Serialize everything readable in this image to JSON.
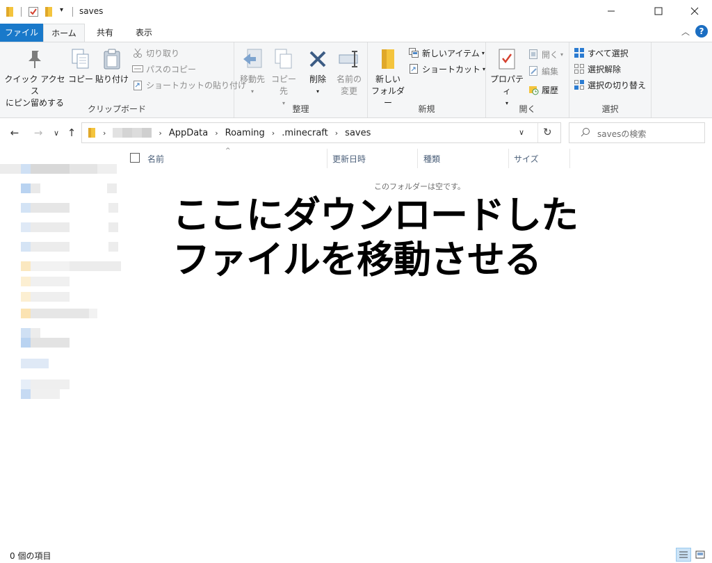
{
  "window": {
    "title": "saves",
    "minimize_glyph": "—",
    "maximize_glyph": "☐",
    "close_glyph": "✕",
    "qa_dropdown_glyph": "▾"
  },
  "tabs": [
    "ファイル",
    "ホーム",
    "共有",
    "表示"
  ],
  "help": {
    "collapse_glyph": "︿",
    "help_glyph": "?"
  },
  "ribbon": {
    "clipboard": {
      "label": "クリップボード",
      "pin_line1": "クイック アクセス",
      "pin_line2": "にピン留めする",
      "copy": "コピー",
      "paste": "貼り付け",
      "cut": "切り取り",
      "copy_path": "パスのコピー",
      "paste_shortcut": "ショートカットの貼り付け"
    },
    "organize": {
      "label": "整理",
      "move_to": "移動先",
      "copy_to": "コピー先",
      "delete": "削除",
      "rename_line1": "名前の",
      "rename_line2": "変更"
    },
    "new": {
      "label": "新規",
      "new_folder_line1": "新しい",
      "new_folder_line2": "フォルダー",
      "new_item": "新しいアイテム",
      "easy_access": "ショートカット"
    },
    "open": {
      "label": "開く",
      "properties": "プロパティ",
      "open": "開く",
      "edit": "編集",
      "history": "履歴"
    },
    "select": {
      "label": "選択",
      "select_all": "すべて選択",
      "select_none": "選択解除",
      "invert": "選択の切り替え"
    }
  },
  "nav": {
    "back": "←",
    "forward": "→",
    "recent": "∨",
    "up": "↑",
    "dropdown": "∨",
    "refresh": "↻",
    "path": [
      "AppData",
      "Roaming",
      ".minecraft",
      "saves"
    ],
    "search_placeholder": "savesの検索"
  },
  "columns": {
    "name": "名前",
    "modified": "更新日時",
    "type": "種類",
    "size": "サイズ",
    "sort_glyph": "^"
  },
  "empty_message": "このフォルダーは空です。",
  "overlay": {
    "line1": "ここにダウンロードした",
    "line2": "ファイルを移動させる"
  },
  "status": {
    "item_count": "0 個の項目"
  },
  "colors": {
    "file_tab": "#1979ca",
    "folder": "#f4c43d",
    "accent_blue": "#2b7bd1",
    "delete_red": "#cf3a3a"
  }
}
